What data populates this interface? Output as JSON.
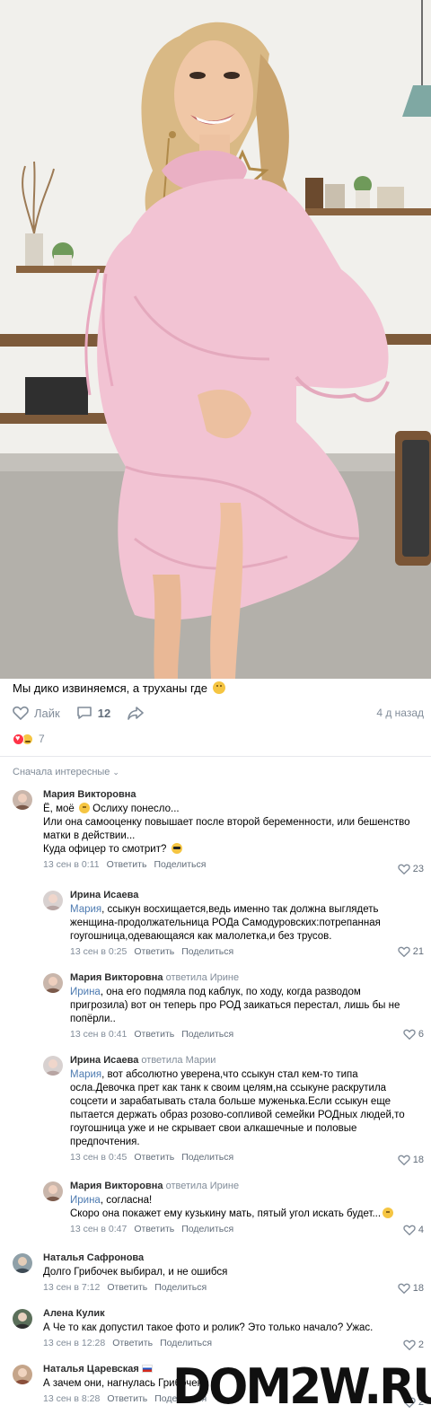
{
  "post": {
    "text": "Мы дико извиняемся, а труханы где",
    "like_label": "Лайк",
    "comments_count": "12",
    "date": "4 д назад",
    "reactions_count": "7"
  },
  "comments_sort": "Сначала интересные",
  "comments": [
    {
      "author": "Мария Викторовна",
      "reply_to": "",
      "mention": "",
      "text": "Ё, моё ",
      "text2": " Ослиху понесло...\nИли она самооценку повышает после второй беременности, или бешенство матки в действии...\nКуда офицер то смотрит? ",
      "date": "13 сен в 0:11",
      "reply_label": "Ответить",
      "share_label": "Поделиться",
      "likes": "23"
    },
    {
      "author": "Ирина Исаева",
      "reply_to": "",
      "mention": "Мария",
      "text": ", ссыкун восхищается,ведь именно так должна выглядеть женщина-продолжательница РОДа Самодуровских:потрепанная гоугошница,одевающаяся как малолетка,и без трусов.",
      "date": "13 сен в 0:25",
      "reply_label": "Ответить",
      "share_label": "Поделиться",
      "likes": "21"
    },
    {
      "author": "Мария Викторовна",
      "reply_to": "ответила Ирине",
      "mention": "Ирина",
      "text": ", она его подмяла под каблук, по ходу, когда разводом пригрозила) вот он теперь про РОД заикаться перестал, лишь бы не попёрли..",
      "date": "13 сен в 0:41",
      "reply_label": "Ответить",
      "share_label": "Поделиться",
      "likes": "6"
    },
    {
      "author": "Ирина Исаева",
      "reply_to": "ответила Марии",
      "mention": "Мария",
      "text": ", вот абсолютно уверена,что ссыкун стал кем-то типа осла.Девочка прет как танк к своим целям,на ссыкуне раскрутила соцсети и зарабатывать стала больше муженька.Если ссыкун еще пытается держать образ розово-сопливой семейки РОДных людей,то гоугошница уже и не скрывает свои алкашечные и половые предпочтения.",
      "date": "13 сен в 0:45",
      "reply_label": "Ответить",
      "share_label": "Поделиться",
      "likes": "18"
    },
    {
      "author": "Мария Викторовна",
      "reply_to": "ответила Ирине",
      "mention": "Ирина",
      "text": ", согласна!\nСкоро она покажет ему кузькину мать, пятый угол искать будет...",
      "date": "13 сен в 0:47",
      "reply_label": "Ответить",
      "share_label": "Поделиться",
      "likes": "4"
    },
    {
      "author": "Наталья Сафронова",
      "reply_to": "",
      "mention": "",
      "text": "Долго Грибочек выбирал, и не ошибся",
      "date": "13 сен в 7:12",
      "reply_label": "Ответить",
      "share_label": "Поделиться",
      "likes": "18"
    },
    {
      "author": "Алена Кулик",
      "reply_to": "",
      "mention": "",
      "text": "А Че то как допустил такое фото и ролик? Это только начало? Ужас.",
      "date": "13 сен в 12:28",
      "reply_label": "Ответить",
      "share_label": "Поделиться",
      "likes": "2"
    },
    {
      "author": "Наталья Царевская",
      "reply_to": "",
      "mention": "",
      "text": "А зачем они, нагнулась Грибочек",
      "date": "13 сен в 8:28",
      "reply_label": "Ответить",
      "share_label": "Поделиться",
      "likes": "2"
    }
  ],
  "watermark": "DOM2W.RU",
  "colors": {
    "link": "#4e7bb1",
    "meta": "#818c99",
    "heart": "#ff3347",
    "dress": "#f2c3d3"
  }
}
